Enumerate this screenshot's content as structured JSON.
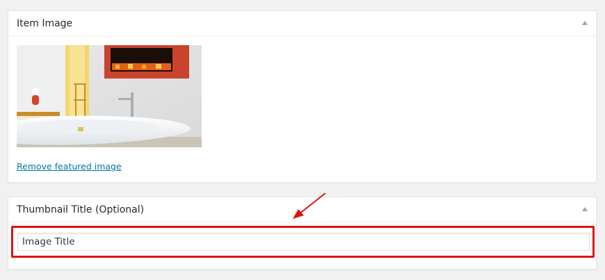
{
  "item_image_box": {
    "title": "Item Image",
    "remove_link": "Remove featured image"
  },
  "thumbnail_title_box": {
    "title": "Thumbnail Title (Optional)",
    "input_value": "Image Title"
  },
  "icons": {
    "toggle": "triangle-up-icon",
    "annotation": "red-arrow-icon"
  },
  "colors": {
    "link": "#0073aa",
    "highlight": "#e01010",
    "page_bg": "#f1f1f1"
  }
}
